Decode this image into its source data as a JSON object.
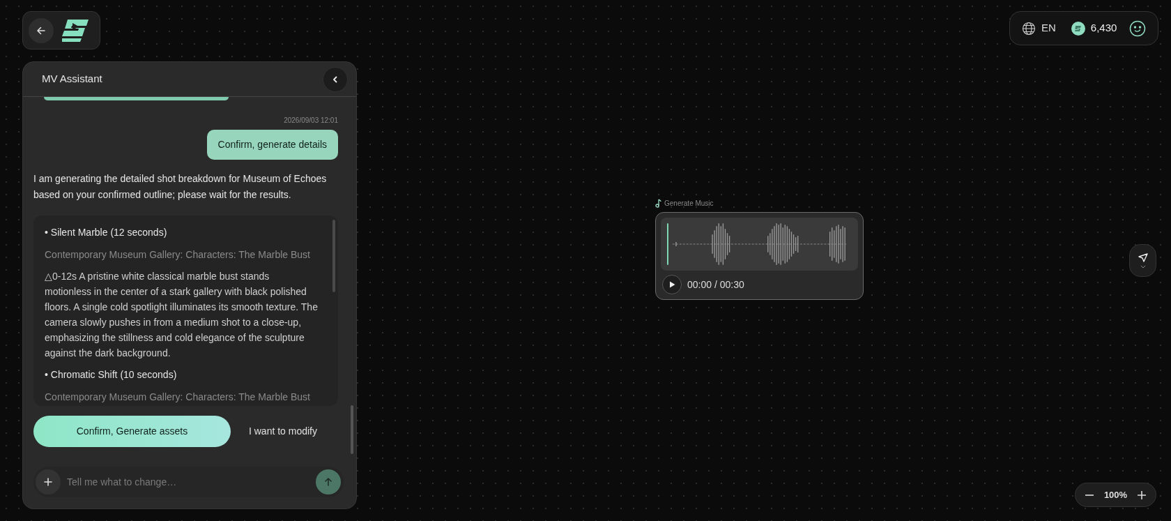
{
  "chat": {
    "title": "MV Assistant",
    "messages": [
      {
        "kind": "user",
        "time": "2026/09/03 12:01",
        "text": "Confirm, generate details"
      },
      {
        "kind": "assistant",
        "text": "I am generating the detailed shot breakdown for Museum of Echoes based on your confirmed outline; please wait for the results."
      },
      {
        "kind": "shots",
        "shots": [
          {
            "title": "• Silent Marble (12 seconds)",
            "location": "Contemporary Museum Gallery: Characters: The Marble Bust",
            "description": "△0-12s A pristine white classical marble bust stands motionless in the center of a stark gallery with black polished floors. A single cold spotlight illuminates its smooth texture. The camera slowly pushes in from a medium shot to a close-up, emphasizing the stillness and cold elegance of the sculpture against the dark background."
          },
          {
            "title": "• Chromatic Shift (10 seconds)",
            "location": "Contemporary Museum Gallery: Characters: The Marble Bust"
          }
        ]
      }
    ],
    "actions": [
      {
        "label": "Confirm, Generate assets",
        "primary": true
      },
      {
        "label": "I want to modify",
        "primary": false
      }
    ],
    "input": {
      "placeholder": "Tell me what to change…"
    }
  },
  "music_node": {
    "label": "Generate Music",
    "time": "00:00 / 00:30"
  },
  "top_right": {
    "language": "EN",
    "credits": "6,430"
  },
  "zoom": {
    "value": "100%"
  }
}
